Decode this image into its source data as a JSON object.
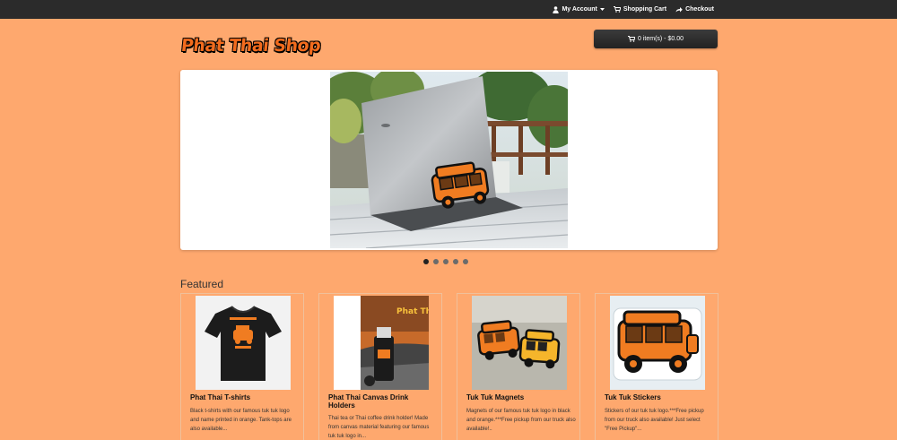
{
  "topnav": {
    "my_account": "My Account",
    "shopping_cart": "Shopping Cart",
    "checkout": "Checkout"
  },
  "header": {
    "logo_text": "Phat Thai Shop",
    "cart_button": "0 item(s) - $0.00"
  },
  "slideshow": {
    "image_alt": "Laptop with tuk tuk sticker on a sunny table",
    "dots": 5,
    "active_dot": 0
  },
  "featured": {
    "title": "Featured",
    "products": [
      {
        "name": "Phat Thai T-shirts",
        "description": "Black t-shirts with our famous tuk tuk logo and name printed in orange. Tank-tops are also available..."
      },
      {
        "name": "Phat Thai Canvas Drink Holders",
        "description": "Thai tea or Thai coffee drink holder! Made from canvas material featuring our famous tuk tuk logo in..."
      },
      {
        "name": "Tuk Tuk Magnets",
        "description": "Magnets of our famous tuk tuk logo in black and orange.***Free pickup from our truck also available!.."
      },
      {
        "name": "Tuk Tuk Stickers",
        "description": "Stickers of our tuk tuk logo.***Free pickup from our truck also available! Just select \"Free Pickup\"..."
      }
    ]
  },
  "colors": {
    "page_bg": "#fea86e",
    "topbar_bg": "#2b2b2b",
    "logo": "#f26b1d",
    "brand_orange": "#f07c21"
  }
}
